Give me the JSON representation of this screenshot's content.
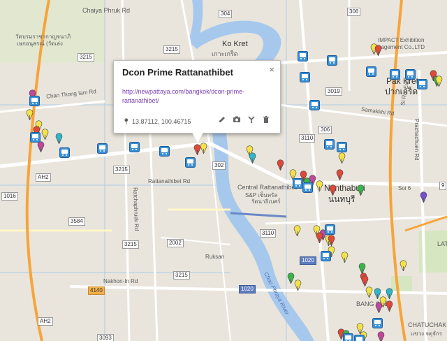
{
  "info_window": {
    "title": "Dcon Prime Rattanathibet",
    "link": "http://newpattaya.com/bangkok/dcon-prime-rattanathibet/",
    "coords": "13.87112, 100.46715",
    "close_glyph": "×",
    "tools": [
      "pencil-icon",
      "camera-icon",
      "route-icon",
      "trash-icon"
    ]
  },
  "labels": {
    "chaiya": "Chaiya Phruk Rd",
    "wat1": "วัดบรมราชากาญจนาภิ",
    "wat2": "เษกอนุสรณ์ (วัดเล่ง",
    "ko_kret": "Ko Kret",
    "ko_kret_th": "เกาะเกร็ด",
    "impact1": "IMPACT Exhibition",
    "impact2": "nagement Co.,LTD",
    "pak_kret": "Pak Kret",
    "pak_kret_th": "ปากเกร็ด",
    "chan_thong": "Chan Thong Iam Rd",
    "samakkhi": "Samakkhi Rd",
    "ratchaphruek": "Ratchaphruek Rd",
    "rattanathibet_rd": "Rattanathibet Rd",
    "central1": "Central Rattanathibet",
    "central2": "S&P เซ็นทรัล",
    "central3": "รัตนาธิเบศร์",
    "nonthaburi": "Nonthaburi",
    "nonthaburi_th": "นนทบุรี",
    "soi6": "Soi 6",
    "ruksan": "Ruksan",
    "nakhon": "Nakhon-In Rd",
    "chao_phraya": "Chao Phraya River",
    "prachachuen": "Prachachuen Rd",
    "expressway": "Si Rat Expy",
    "bang_sue": "BANG SUE",
    "chatuchak": "CHATUCHAK",
    "chatuchak_th": "แขวง จตุจักร",
    "lat": "LAT"
  },
  "shields": {
    "s304": "304",
    "s306": "306",
    "s3215a": "3215",
    "s3215b": "3215",
    "s3215c": "3215",
    "s3019": "3019",
    "s3110a": "3110",
    "s3110b": "3110",
    "s302": "302",
    "s3584": "3584",
    "s1016": "1016",
    "s2002": "2002",
    "s1020a": "1020",
    "s1020b": "1020",
    "s4140": "4140",
    "s3093": "3093",
    "ah2a": "AH2",
    "ah2b": "AH2",
    "ah2c": "AH2",
    "s9": "9"
  }
}
